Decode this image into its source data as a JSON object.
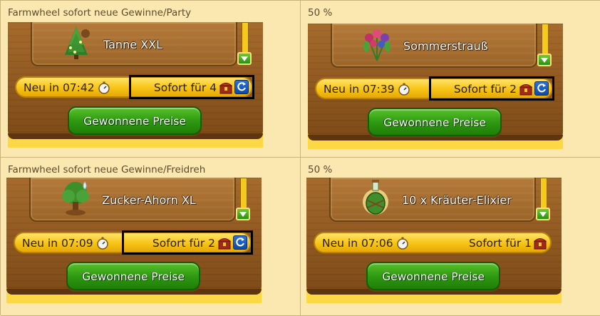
{
  "cells": [
    {
      "caption": "Farmwheel sofort neue Gewinne/Party",
      "prize": {
        "name": "Tanne XXL",
        "icon": "fir-tree-icon"
      },
      "timer": {
        "label": "Neu in 07:42"
      },
      "instant": {
        "label": "Sofort für 4",
        "highlighted": true
      },
      "button": {
        "label": "Gewonnene Preise"
      }
    },
    {
      "caption": "50 %",
      "prize": {
        "name": "Sommerstrauß",
        "icon": "flower-bouquet-icon"
      },
      "timer": {
        "label": "Neu in 07:39"
      },
      "instant": {
        "label": "Sofort für 2",
        "highlighted": true
      },
      "button": {
        "label": "Gewonnene Preise"
      }
    },
    {
      "caption": "Farmwheel sofort neue Gewinne/Freidreh",
      "prize": {
        "name": "Zucker-Ahorn XL",
        "icon": "maple-tree-icon"
      },
      "timer": {
        "label": "Neu in 07:09"
      },
      "instant": {
        "label": "Sofort für 2",
        "highlighted": true
      },
      "button": {
        "label": "Gewonnene Preise"
      }
    },
    {
      "caption": "50 %",
      "prize": {
        "name": "10 x Kräuter-Elixier",
        "icon": "elixir-bottle-icon"
      },
      "timer": {
        "label": "Neu in 07:06"
      },
      "instant": {
        "label": "Sofort für 1",
        "highlighted": false
      },
      "button": {
        "label": "Gewonnene Preise"
      }
    }
  ],
  "colors": {
    "background": "#fbe8b1",
    "wood": "#8f5820",
    "bar": "#f7c414",
    "button": "#2f9a12"
  }
}
